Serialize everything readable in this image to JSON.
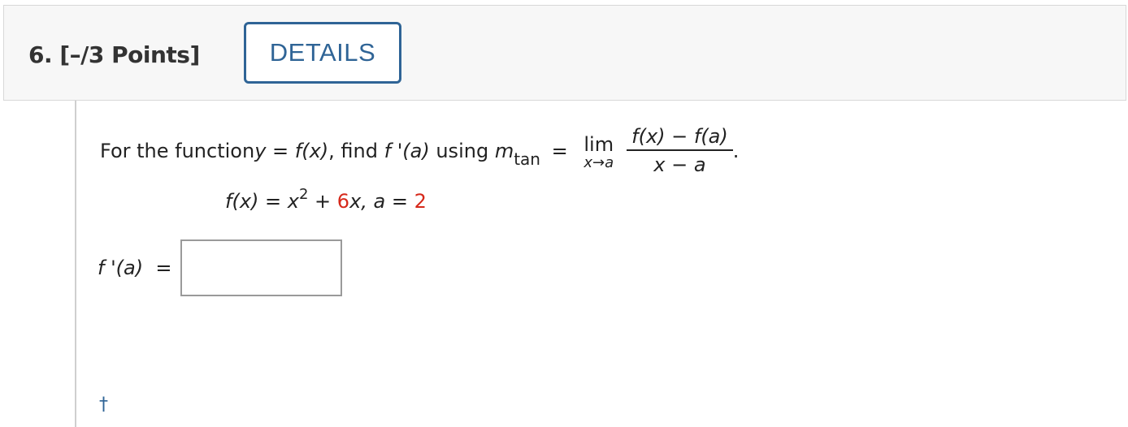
{
  "question": {
    "title": "6. [–/3 Points]",
    "details_label": "DETAILS"
  },
  "prompt": {
    "text_1": "For the function ",
    "y": "y",
    "eq1": " = ",
    "fx": "f(x)",
    "text_2": ", find ",
    "fprime_a": "f '(a)",
    "text_3": " using ",
    "m": "m",
    "m_sub": "tan",
    "eq2": " = ",
    "lim": "lim",
    "lim_under": "x→a",
    "numerator": "f(x) − f(a)",
    "denominator": "x − a",
    "period": "."
  },
  "function_line": {
    "lhs": "f(x) = x",
    "exp": "2",
    "plus": " + ",
    "coef": "6",
    "x_part": "x, ",
    "a_var": "a",
    "a_eq": " = ",
    "a_value": "2"
  },
  "answer": {
    "label": "f '(a)  =",
    "value": ""
  },
  "footnote": {
    "dagger": "†"
  },
  "colors": {
    "accent": "#2f6496",
    "highlight": "#d6281a",
    "header_bg": "#f7f7f7"
  }
}
